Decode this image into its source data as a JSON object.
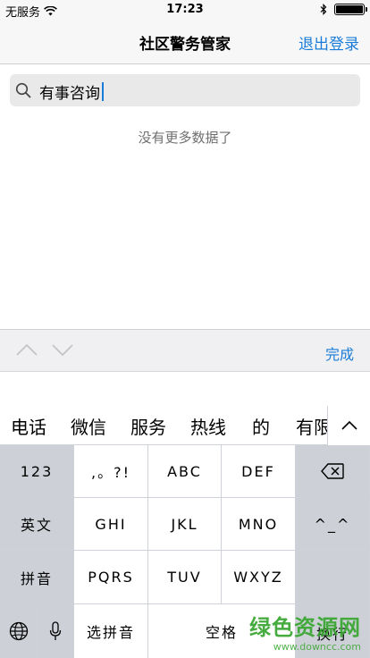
{
  "status_bar": {
    "carrier": "无服务",
    "time": "17:23",
    "battery_level": 1.0
  },
  "nav": {
    "title": "社区警务管家",
    "logout": "退出登录"
  },
  "search": {
    "value": "有事咨询"
  },
  "empty_message": "没有更多数据了",
  "accessory": {
    "done": "完成"
  },
  "candidates": [
    "电话",
    "微信",
    "服务",
    "热线",
    "的",
    "有限"
  ],
  "keyboard": {
    "num": "123",
    "punct": ",。?!",
    "abc": "ABC",
    "def": "DEF",
    "english": "英文",
    "ghi": "GHI",
    "jkl": "JKL",
    "mno": "MNO",
    "emoticon": "^_^",
    "pinyin": "拼音",
    "pqrs": "PQRS",
    "tuv": "TUV",
    "wxyz": "WXYZ",
    "select_pinyin": "选拼音",
    "space": "空格",
    "newline": "换行"
  },
  "watermark": {
    "name": "绿色资源网",
    "url": "www.downcc.com"
  },
  "colors": {
    "accent": "#1a7cd9",
    "watermark": "#38a630"
  }
}
